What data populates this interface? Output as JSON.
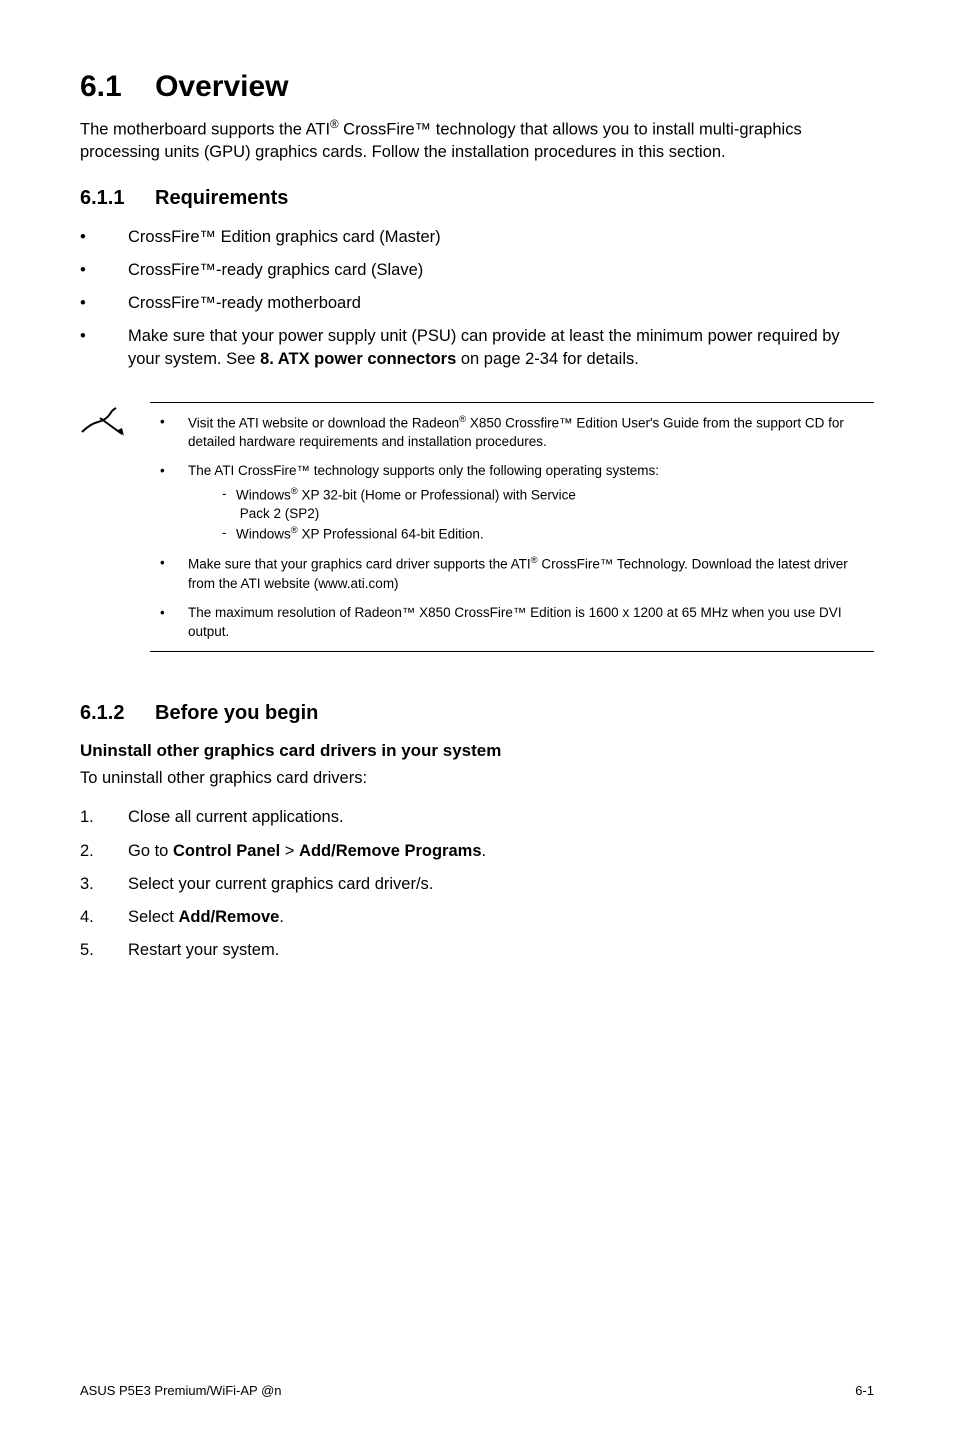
{
  "section_number": "6.1",
  "section_title": "Overview",
  "intro": "The motherboard supports the ATI® CrossFire™ technology that allows you to install multi-graphics processing units (GPU) graphics cards. Follow the installation procedures in this section.",
  "sub1": {
    "num": "6.1.1",
    "title": "Requirements",
    "items": [
      "CrossFire™ Edition graphics card (Master)",
      "CrossFire™-ready graphics card (Slave)",
      "CrossFire™-ready motherboard",
      "Make sure that your power supply unit (PSU) can provide at least the minimum power required by your system. See <b>8. ATX power connectors</b> on page 2-34 for details."
    ]
  },
  "notes": [
    {
      "text": "Visit the ATI website or download the Radeon® X850 Crossfire™ Edition User's Guide from the support CD for detailed hardware requirements and installation procedures."
    },
    {
      "text": "The ATI CrossFire™ technology supports only the following operating systems:",
      "sub": [
        "Windows® XP 32-bit  (Home or Professional) with Service Pack 2 (SP2)",
        "Windows® XP Professional 64-bit Edition."
      ]
    },
    {
      "text": "Make sure that your graphics card driver supports the ATI® CrossFire™ Technology. Download the latest driver from the ATI website (www.ati.com)"
    },
    {
      "text": "The maximum resolution of Radeon™ X850 CrossFire™ Edition is 1600 x 1200 at 65 MHz when you use DVI output."
    }
  ],
  "sub2": {
    "num": "6.1.2",
    "title": "Before you begin",
    "subhead": "Uninstall other graphics card drivers in your system",
    "lead": "To uninstall other graphics card drivers:",
    "steps": [
      "Close all current applications.",
      "Go to <b>Control Panel</b> > <b>Add/Remove Programs</b>.",
      "Select your current graphics card driver/s.",
      "Select <b>Add/Remove</b>.",
      "Restart your system."
    ]
  },
  "footer_left": "ASUS P5E3 Premium/WiFi-AP @n",
  "footer_right": "6-1"
}
